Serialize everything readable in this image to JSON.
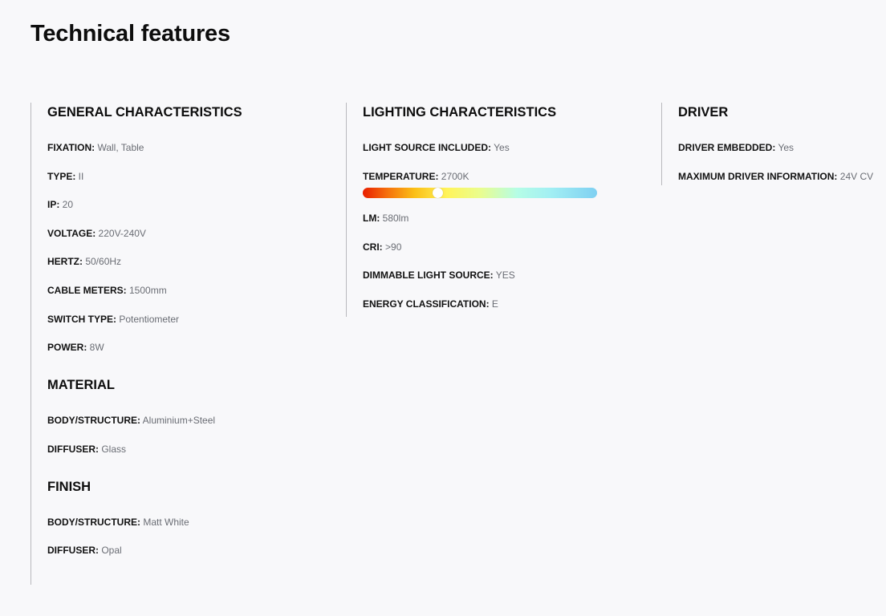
{
  "page": {
    "title": "Technical features"
  },
  "columns": [
    {
      "sections": [
        {
          "title": "GENERAL CHARACTERISTICS",
          "items": [
            {
              "label": "FIXATION:",
              "value": " Wall, Table"
            },
            {
              "label": "TYPE:",
              "value": " II"
            },
            {
              "label": "IP:",
              "value": " 20"
            },
            {
              "label": "VOLTAGE:",
              "value": " 220V-240V"
            },
            {
              "label": "HERTZ:",
              "value": " 50/60Hz"
            },
            {
              "label": "CABLE METERS:",
              "value": " 1500mm"
            },
            {
              "label": "SWITCH TYPE:",
              "value": " Potentiometer"
            },
            {
              "label": "POWER:",
              "value": " 8W"
            }
          ]
        },
        {
          "title": "MATERIAL",
          "items": [
            {
              "label": "BODY/STRUCTURE:",
              "value": " Aluminium+Steel"
            },
            {
              "label": "DIFFUSER:",
              "value": " Glass"
            }
          ]
        },
        {
          "title": "FINISH",
          "items": [
            {
              "label": "BODY/STRUCTURE:",
              "value": " Matt White"
            },
            {
              "label": "DIFFUSER:",
              "value": " Opal"
            }
          ]
        }
      ]
    },
    {
      "sections": [
        {
          "title": "LIGHTING CHARACTERISTICS",
          "items": [
            {
              "label": "LIGHT SOURCE INCLUDED:",
              "value": " Yes"
            },
            {
              "label": "TEMPERATURE:",
              "value": " 2700K"
            },
            {
              "label": "LM:",
              "value": " 580lm"
            },
            {
              "label": "CRI:",
              "value": " >90"
            },
            {
              "label": "DIMMABLE LIGHT SOURCE:",
              "value": " YES"
            },
            {
              "label": "ENERGY CLASSIFICATION:",
              "value": " E"
            }
          ],
          "temperature_scale": {
            "marker_fraction": 0.32,
            "colors": [
              "#e81d00",
              "#fbbf16",
              "#fff45a",
              "#b5fde6",
              "#7fd0f2"
            ]
          }
        }
      ]
    },
    {
      "sections": [
        {
          "title": "DRIVER",
          "items": [
            {
              "label": "DRIVER EMBEDDED:",
              "value": " Yes"
            },
            {
              "label": "MAXIMUM DRIVER INFORMATION:",
              "value": " 24V CV"
            }
          ]
        }
      ]
    }
  ]
}
